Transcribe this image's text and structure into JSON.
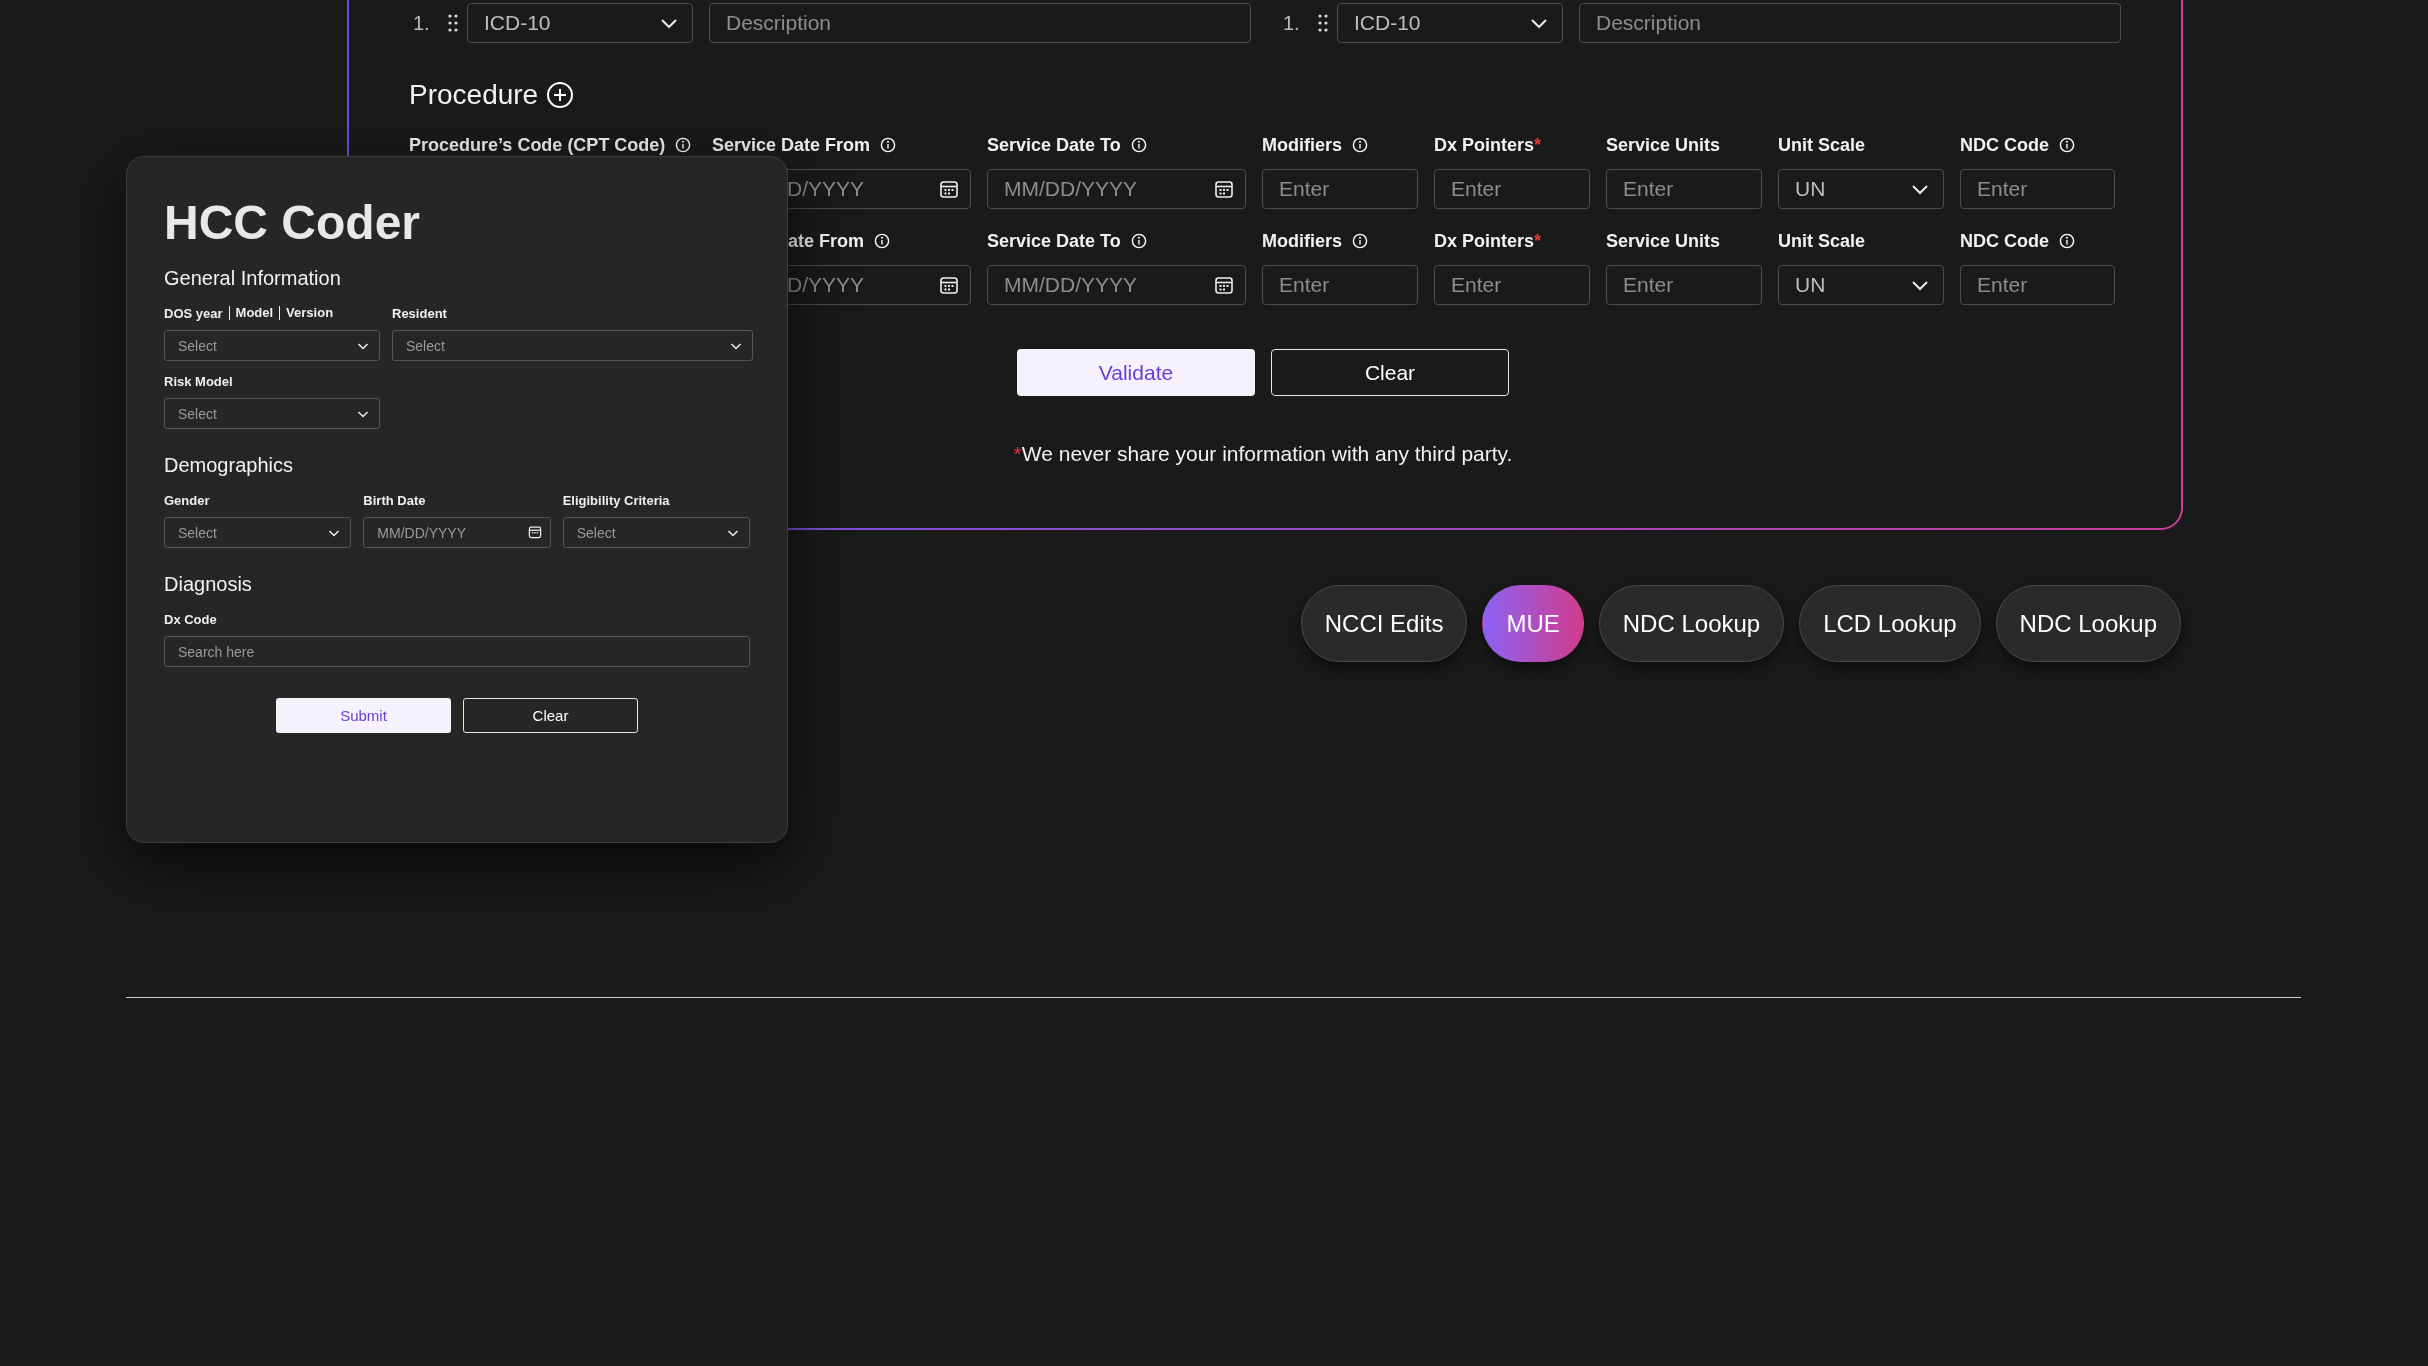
{
  "icd_groups": [
    {
      "number": "1.",
      "code": "ICD-10",
      "description_placeholder": "Description"
    },
    {
      "number": "1.",
      "code": "ICD-10",
      "description_placeholder": "Description"
    }
  ],
  "procedure": {
    "title": "Procedure",
    "rows": [
      {
        "fields": [
          {
            "label": "Procedure’s Code (CPT Code)",
            "info": true
          },
          {
            "label": "Service Date From",
            "info": true,
            "kind": "date",
            "placeholder": "D/YYYY",
            "input_cut": true
          },
          {
            "label": "Service Date To",
            "info": true,
            "kind": "date",
            "placeholder": "MM/DD/YYYY"
          },
          {
            "label": "Modifiers",
            "info": true,
            "kind": "text",
            "placeholder": "Enter"
          },
          {
            "label": "Dx Pointers",
            "required": true,
            "kind": "text",
            "placeholder": "Enter"
          },
          {
            "label": "Service Units",
            "kind": "text",
            "placeholder": "Enter"
          },
          {
            "label": "Unit Scale",
            "kind": "select",
            "value": "UN"
          },
          {
            "label": "NDC Code",
            "info": true,
            "kind": "text",
            "placeholder": "Enter"
          }
        ]
      },
      {
        "fields": [
          {
            "label": "ate From",
            "label_cut": true,
            "info": true,
            "kind": "date",
            "placeholder": "D/YYYY",
            "input_cut": true
          },
          {
            "label": "Service Date To",
            "info": true,
            "kind": "date",
            "placeholder": "MM/DD/YYYY"
          },
          {
            "label": "Modifiers",
            "info": true,
            "kind": "text",
            "placeholder": "Enter"
          },
          {
            "label": "Dx Pointers",
            "required": true,
            "kind": "text",
            "placeholder": "Enter"
          },
          {
            "label": "Service Units",
            "kind": "text",
            "placeholder": "Enter"
          },
          {
            "label": "Unit Scale",
            "kind": "select",
            "value": "UN"
          },
          {
            "label": "NDC Code",
            "info": true,
            "kind": "text",
            "placeholder": "Enter"
          }
        ]
      }
    ]
  },
  "actions": [
    {
      "label": "Validate",
      "kind": "primary"
    },
    {
      "label": "Clear",
      "kind": "outline"
    }
  ],
  "note": {
    "mark": "*",
    "text": "We never share your information with any third party."
  },
  "tools": [
    {
      "label": "NCCI Edits",
      "selected": false
    },
    {
      "label": "MUE",
      "selected": true
    },
    {
      "label": "NDC Lookup",
      "selected": false
    },
    {
      "label": "LCD Lookup",
      "selected": false
    },
    {
      "label": "NDC Lookup",
      "selected": false
    }
  ],
  "hcc_coder": {
    "title": "HCC Coder",
    "sections": [
      {
        "title": "General Information",
        "fields": [
          {
            "label_parts": [
              "DOS year",
              "Model",
              "Version"
            ],
            "kind": "select",
            "placeholder": "Select"
          },
          {
            "label": "Resident",
            "kind": "select",
            "placeholder": "Select"
          },
          {
            "label": "Risk Model",
            "kind": "select",
            "placeholder": "Select"
          }
        ]
      },
      {
        "title": "Demographics",
        "fields": [
          {
            "label": "Gender",
            "kind": "select",
            "placeholder": "Select"
          },
          {
            "label": "Birth Date",
            "kind": "date",
            "placeholder": "MM/DD/YYYY"
          },
          {
            "label": "Eligibility Criteria",
            "kind": "select",
            "placeholder": "Select"
          }
        ]
      },
      {
        "title": "Diagnosis",
        "fields": [
          {
            "label": "Dx Code",
            "kind": "search",
            "placeholder": "Search here"
          }
        ]
      }
    ],
    "actions": [
      {
        "label": "Submit",
        "kind": "primary"
      },
      {
        "label": "Clear",
        "kind": "outline"
      }
    ]
  }
}
